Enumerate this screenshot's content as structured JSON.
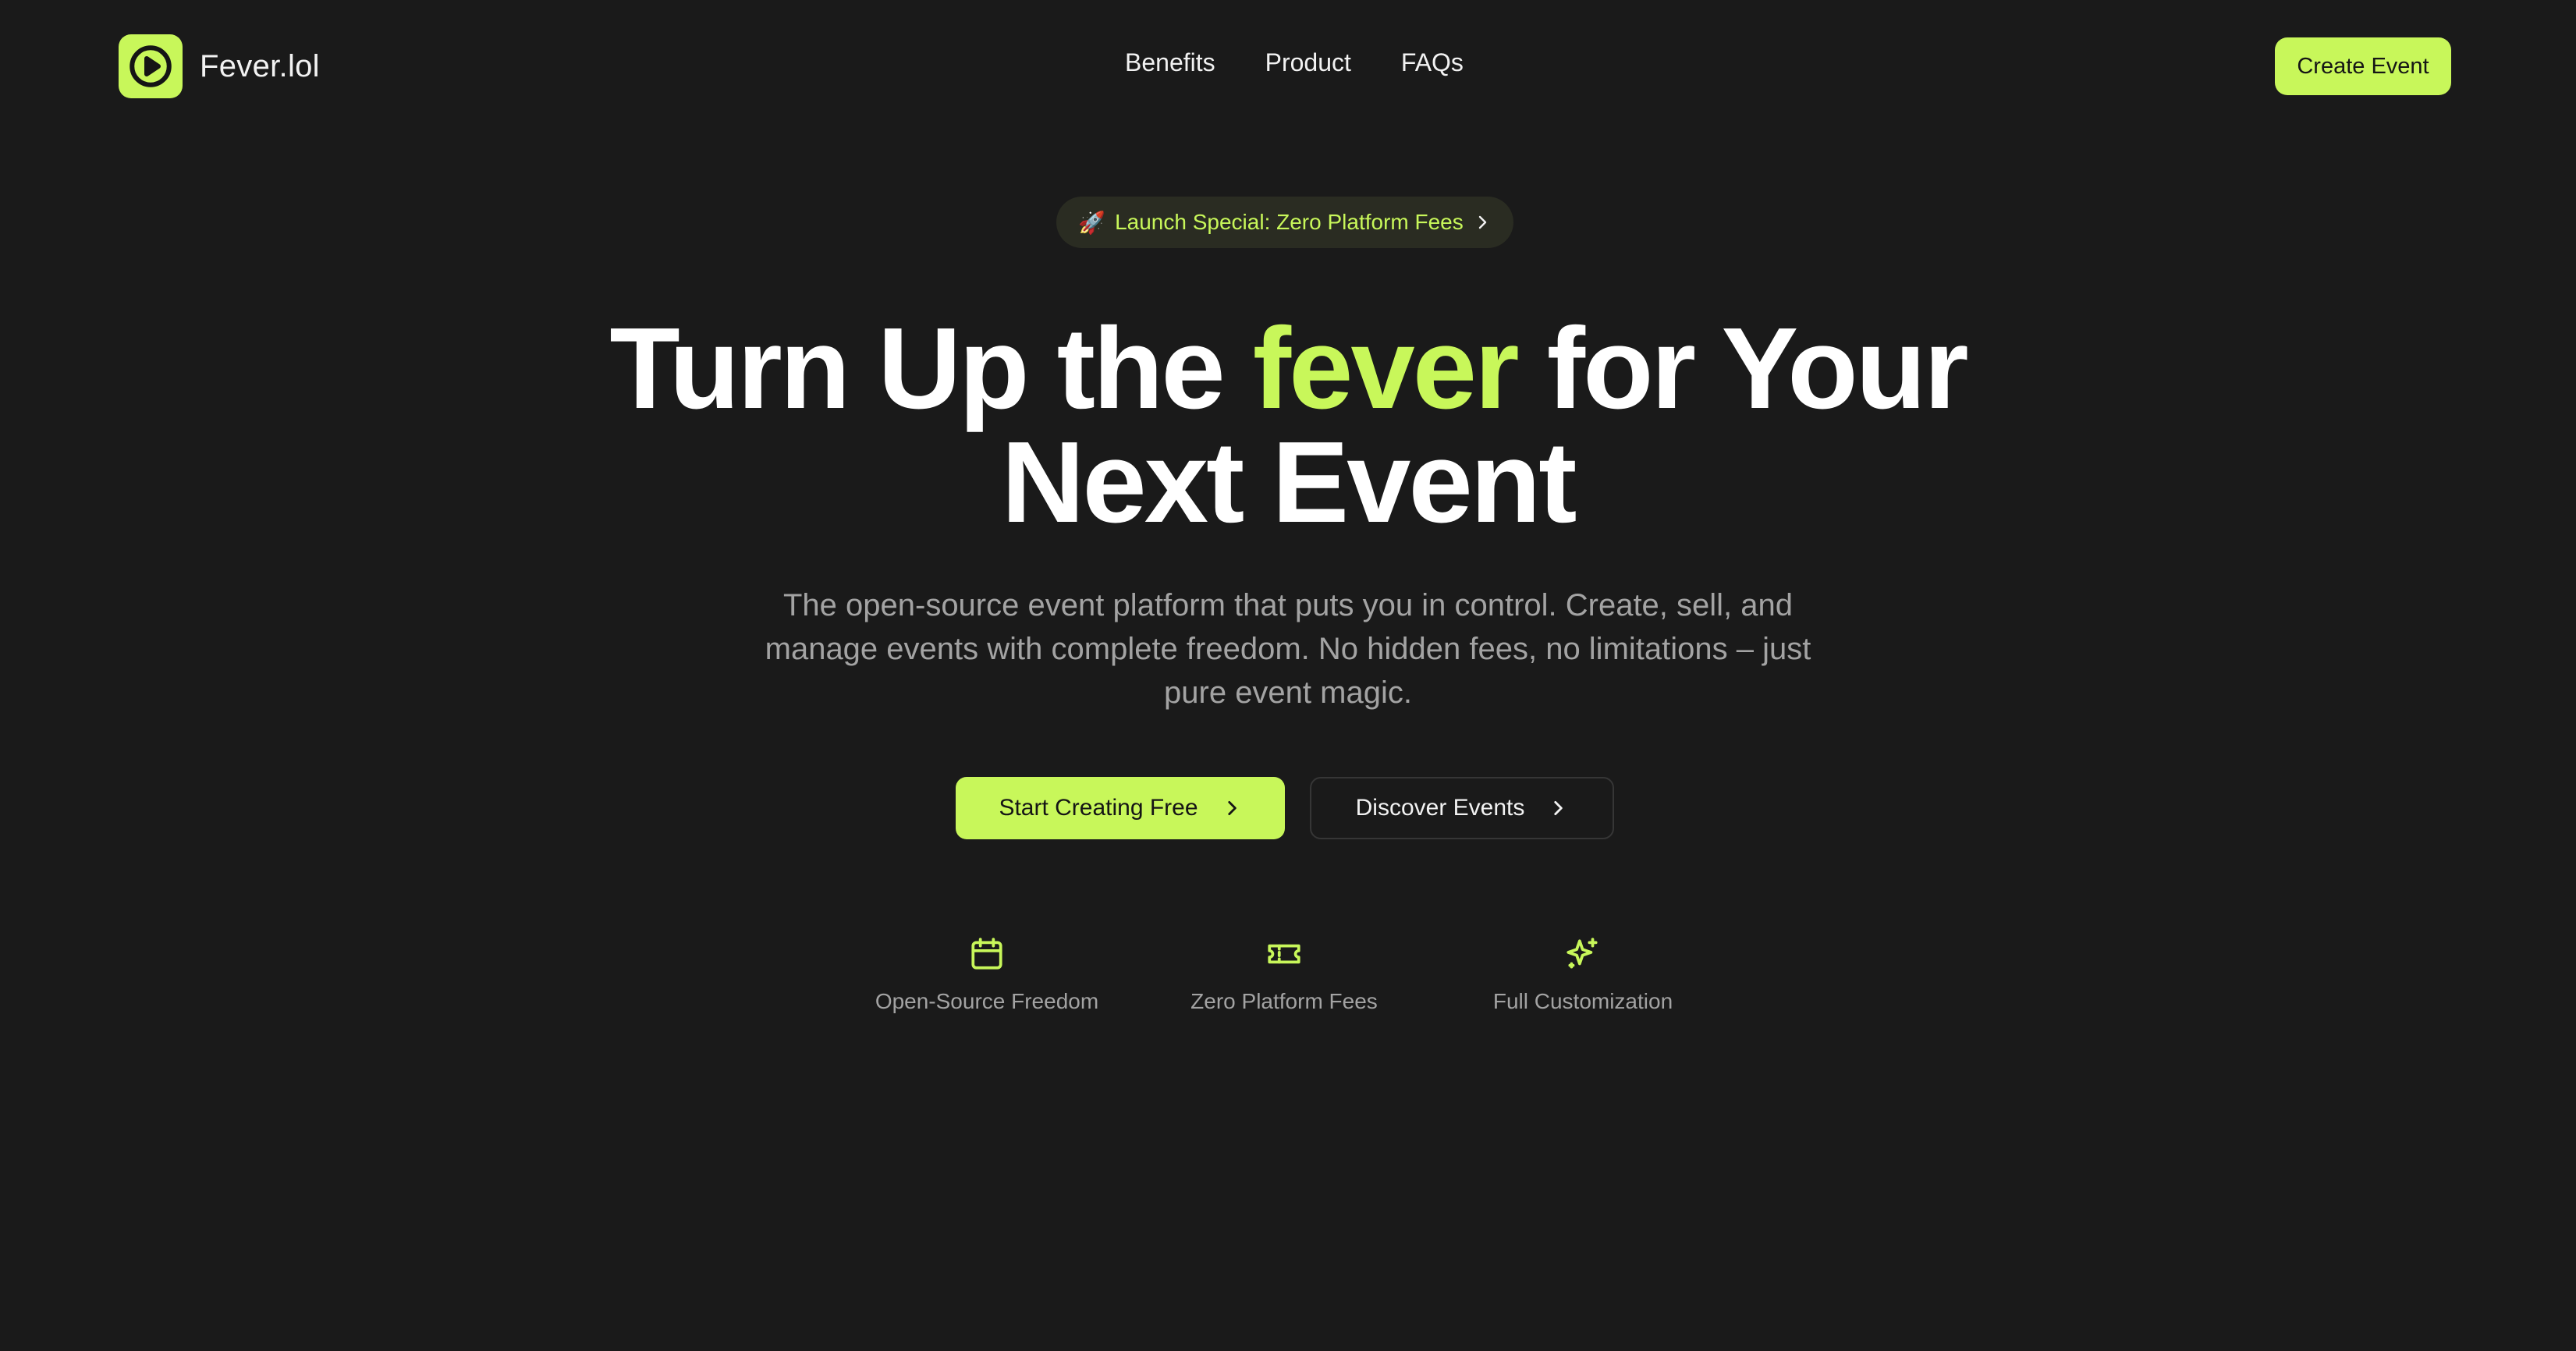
{
  "brand": {
    "name": "Fever.lol",
    "logo_icon": "play-circle-icon"
  },
  "nav": {
    "items": [
      "Benefits",
      "Product",
      "FAQs"
    ]
  },
  "header": {
    "cta_label": "Create Event"
  },
  "badge": {
    "emoji": "🚀",
    "text": "Launch Special: Zero Platform Fees",
    "icon": "chevron-right-icon"
  },
  "hero": {
    "title_part1": "Turn Up the ",
    "title_accent": "fever",
    "title_part2": " for Your",
    "title_line2": "Next Event",
    "subtitle": "The open-source event platform that puts you in control. Create, sell, and manage events with complete freedom. No hidden fees, no limitations – just pure event magic.",
    "primary_button": "Start Creating Free",
    "secondary_button": "Discover Events"
  },
  "features": [
    {
      "label": "Open-Source Freedom",
      "icon": "calendar-icon"
    },
    {
      "label": "Zero Platform Fees",
      "icon": "ticket-icon"
    },
    {
      "label": "Full Customization",
      "icon": "sparkles-icon"
    }
  ],
  "colors": {
    "background": "#1a1a1a",
    "accent": "#c8f75a",
    "muted_text": "#a3a3a3",
    "text": "#ffffff"
  }
}
